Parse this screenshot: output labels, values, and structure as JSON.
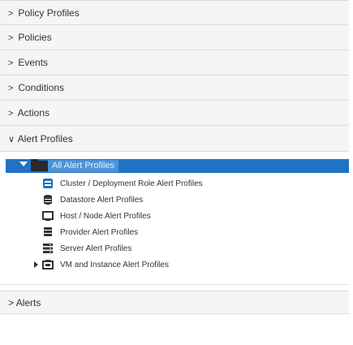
{
  "accordion": {
    "sections": [
      {
        "label": "Policy Profiles",
        "chevron": ">"
      },
      {
        "label": "Policies",
        "chevron": ">"
      },
      {
        "label": "Events",
        "chevron": ">"
      },
      {
        "label": "Conditions",
        "chevron": ">"
      },
      {
        "label": "Actions",
        "chevron": ">"
      },
      {
        "label": "Alert Profiles",
        "chevron": "∨"
      }
    ],
    "alerts": {
      "label": "Alerts",
      "chevron": ">"
    }
  },
  "tree": {
    "root_label": "All Alert Profiles",
    "items": [
      {
        "label": "Cluster / Deployment Role Alert Profiles",
        "icon": "cluster-icon"
      },
      {
        "label": "Datastore Alert Profiles",
        "icon": "datastore-icon"
      },
      {
        "label": "Host / Node Alert Profiles",
        "icon": "host-icon"
      },
      {
        "label": "Provider Alert Profiles",
        "icon": "provider-icon"
      },
      {
        "label": "Server Alert Profiles",
        "icon": "server-icon"
      },
      {
        "label": "VM and Instance Alert Profiles",
        "icon": "vm-icon"
      }
    ]
  },
  "colors": {
    "selection": "#1f73c4",
    "header_bg": "#f5f5f5",
    "border": "#dcdcdc"
  }
}
